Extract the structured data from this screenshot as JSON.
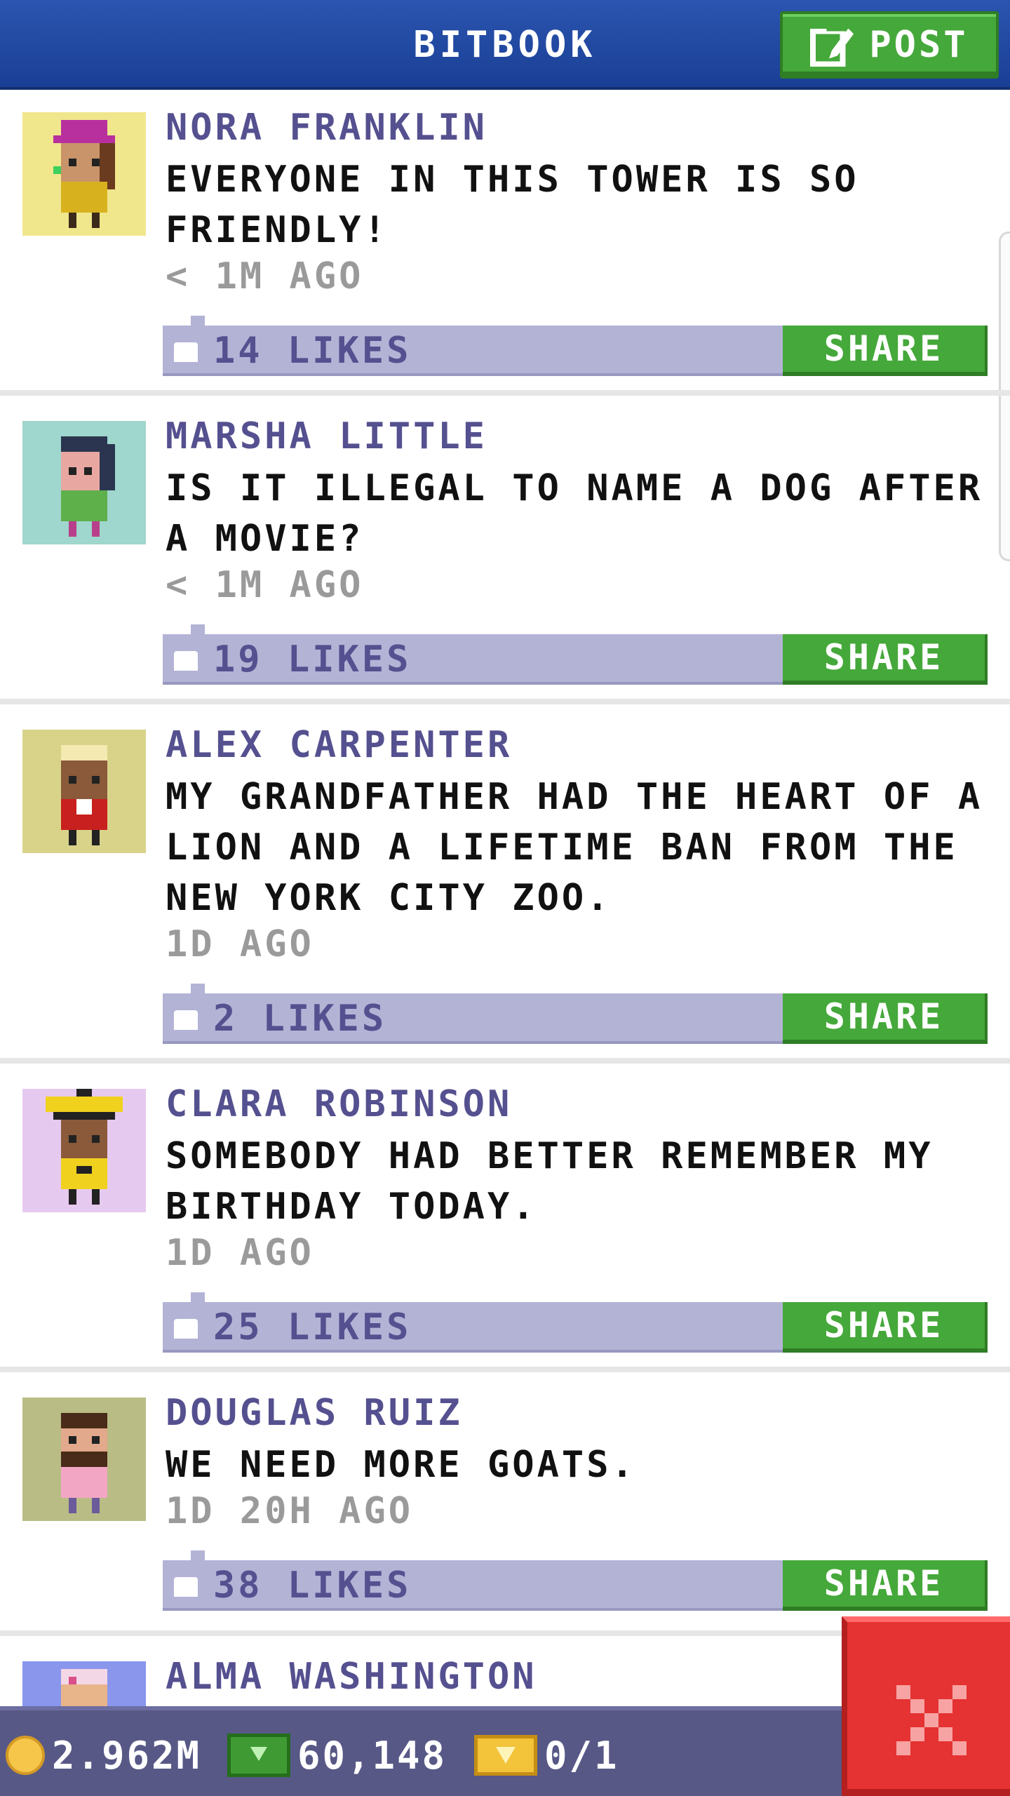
{
  "header": {
    "title": "BITBOOK",
    "post_label": "POST"
  },
  "posts": [
    {
      "author": "NORA FRANKLIN",
      "message": "EVERYONE IN THIS TOWER IS SO FRIENDLY!",
      "time": "< 1M AGO",
      "likes": "14 LIKES",
      "share_label": "SHARE",
      "avatar_bg": "#f0e68c"
    },
    {
      "author": "MARSHA LITTLE",
      "message": "IS IT ILLEGAL TO NAME A DOG AFTER A MOVIE?",
      "time": "< 1M AGO",
      "likes": "19 LIKES",
      "share_label": "SHARE",
      "avatar_bg": "#9fd6cd"
    },
    {
      "author": "ALEX CARPENTER",
      "message": "MY GRANDFATHER HAD THE HEART OF A LION AND A LIFETIME BAN FROM THE NEW YORK CITY ZOO.",
      "time": "1D AGO",
      "likes": "2 LIKES",
      "share_label": "SHARE",
      "avatar_bg": "#d8d389"
    },
    {
      "author": "CLARA ROBINSON",
      "message": "SOMEBODY HAD BETTER REMEMBER MY BIRTHDAY TODAY.",
      "time": "1D AGO",
      "likes": "25 LIKES",
      "share_label": "SHARE",
      "avatar_bg": "#e6c9ef"
    },
    {
      "author": "DOUGLAS RUIZ",
      "message": "WE NEED MORE GOATS.",
      "time": "1D 20H AGO",
      "likes": "38 LIKES",
      "share_label": "SHARE",
      "avatar_bg": "#b9bc84"
    },
    {
      "author": "ALMA WASHINGTON",
      "avatar_bg": "#8a96ec"
    }
  ],
  "status": {
    "coins": "2.962M",
    "bux": "60,148",
    "tickets": "0/1"
  },
  "colors": {
    "header": "#2b55b0",
    "accent_green": "#45a83a",
    "like_bar": "#b3b3d6",
    "author_purple": "#55508f",
    "close_red": "#e53232"
  }
}
